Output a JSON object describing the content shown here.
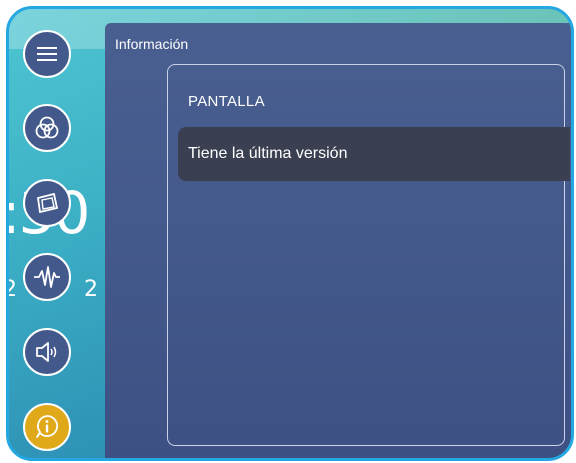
{
  "background": {
    "clock_fragment": ":30",
    "date_fragment": "2 20"
  },
  "panel": {
    "title": "Información",
    "section_label": "PANTALLA",
    "status_text": "Tiene la última versión"
  },
  "sidebar": {
    "items": [
      {
        "icon": "menu-icon",
        "active": false
      },
      {
        "icon": "color-circles-icon",
        "active": false
      },
      {
        "icon": "display-frame-icon",
        "active": false
      },
      {
        "icon": "waveform-icon",
        "active": false
      },
      {
        "icon": "speaker-icon",
        "active": false
      },
      {
        "icon": "info-icon",
        "active": true
      }
    ]
  },
  "colors": {
    "frame_border": "#25a7e1",
    "panel": "#44598b",
    "status_row": "#3b3f52",
    "active_button": "#e0a91a"
  }
}
